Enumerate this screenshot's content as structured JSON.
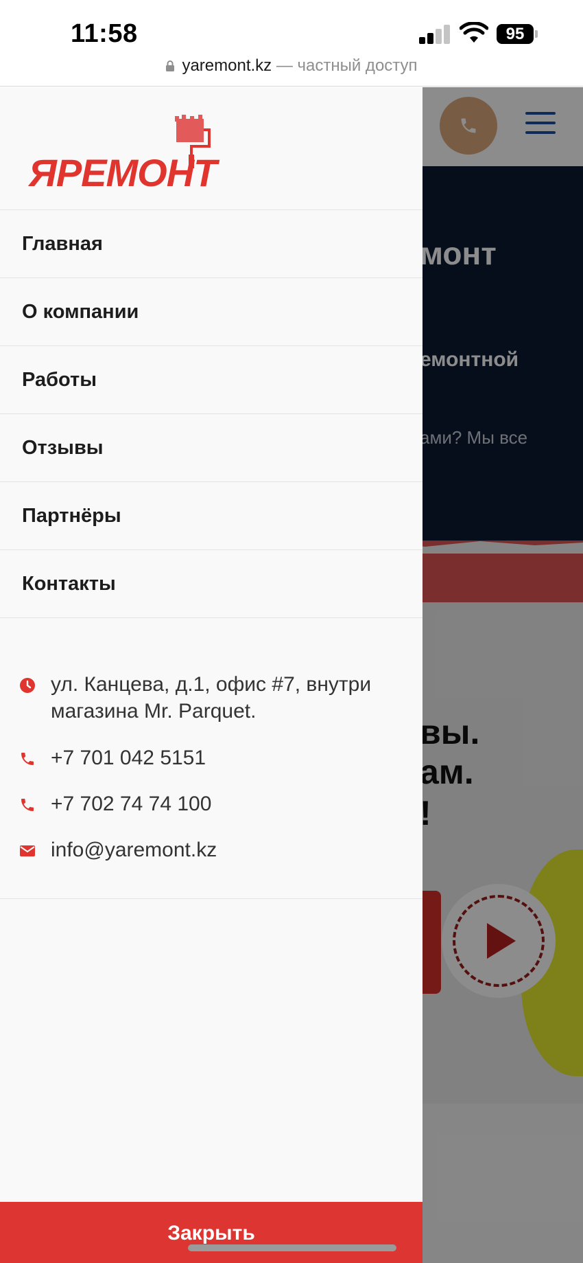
{
  "status_bar": {
    "time": "11:58",
    "battery": "95",
    "url": "yaremont.kz",
    "url_suffix": "— частный доступ"
  },
  "background_page": {
    "hero_title_fragment": "монт",
    "hero_subtitle_fragment": "емонтной",
    "hero_text_fragment": "ами? Мы все",
    "photo_text_line1": "вы.",
    "photo_text_line2": "ам.",
    "photo_text_line3": "!"
  },
  "drawer": {
    "logo_text": "ЯРЕМОНТ",
    "menu": [
      {
        "label": "Главная"
      },
      {
        "label": "О компании"
      },
      {
        "label": "Работы"
      },
      {
        "label": "Отзывы"
      },
      {
        "label": "Партнёры"
      },
      {
        "label": "Контакты"
      }
    ],
    "contacts": {
      "address": "ул. Канцева, д.1, офис #7, внутри магазина Mr. Parquet.",
      "phone1": "+7 701 042 5151",
      "phone2": "+7 702 74 74 100",
      "email": "info@yaremont.kz"
    },
    "close_label": "Закрыть"
  },
  "colors": {
    "brand_red": "#dd3531",
    "menu_text": "#1d1d1d",
    "drawer_bg": "#f9f9f9",
    "hero_dark": "#0b1a33",
    "burger_blue": "#1f4fa3"
  },
  "icons": {
    "address": "clock-icon",
    "phone": "phone-icon",
    "email": "envelope-icon"
  }
}
